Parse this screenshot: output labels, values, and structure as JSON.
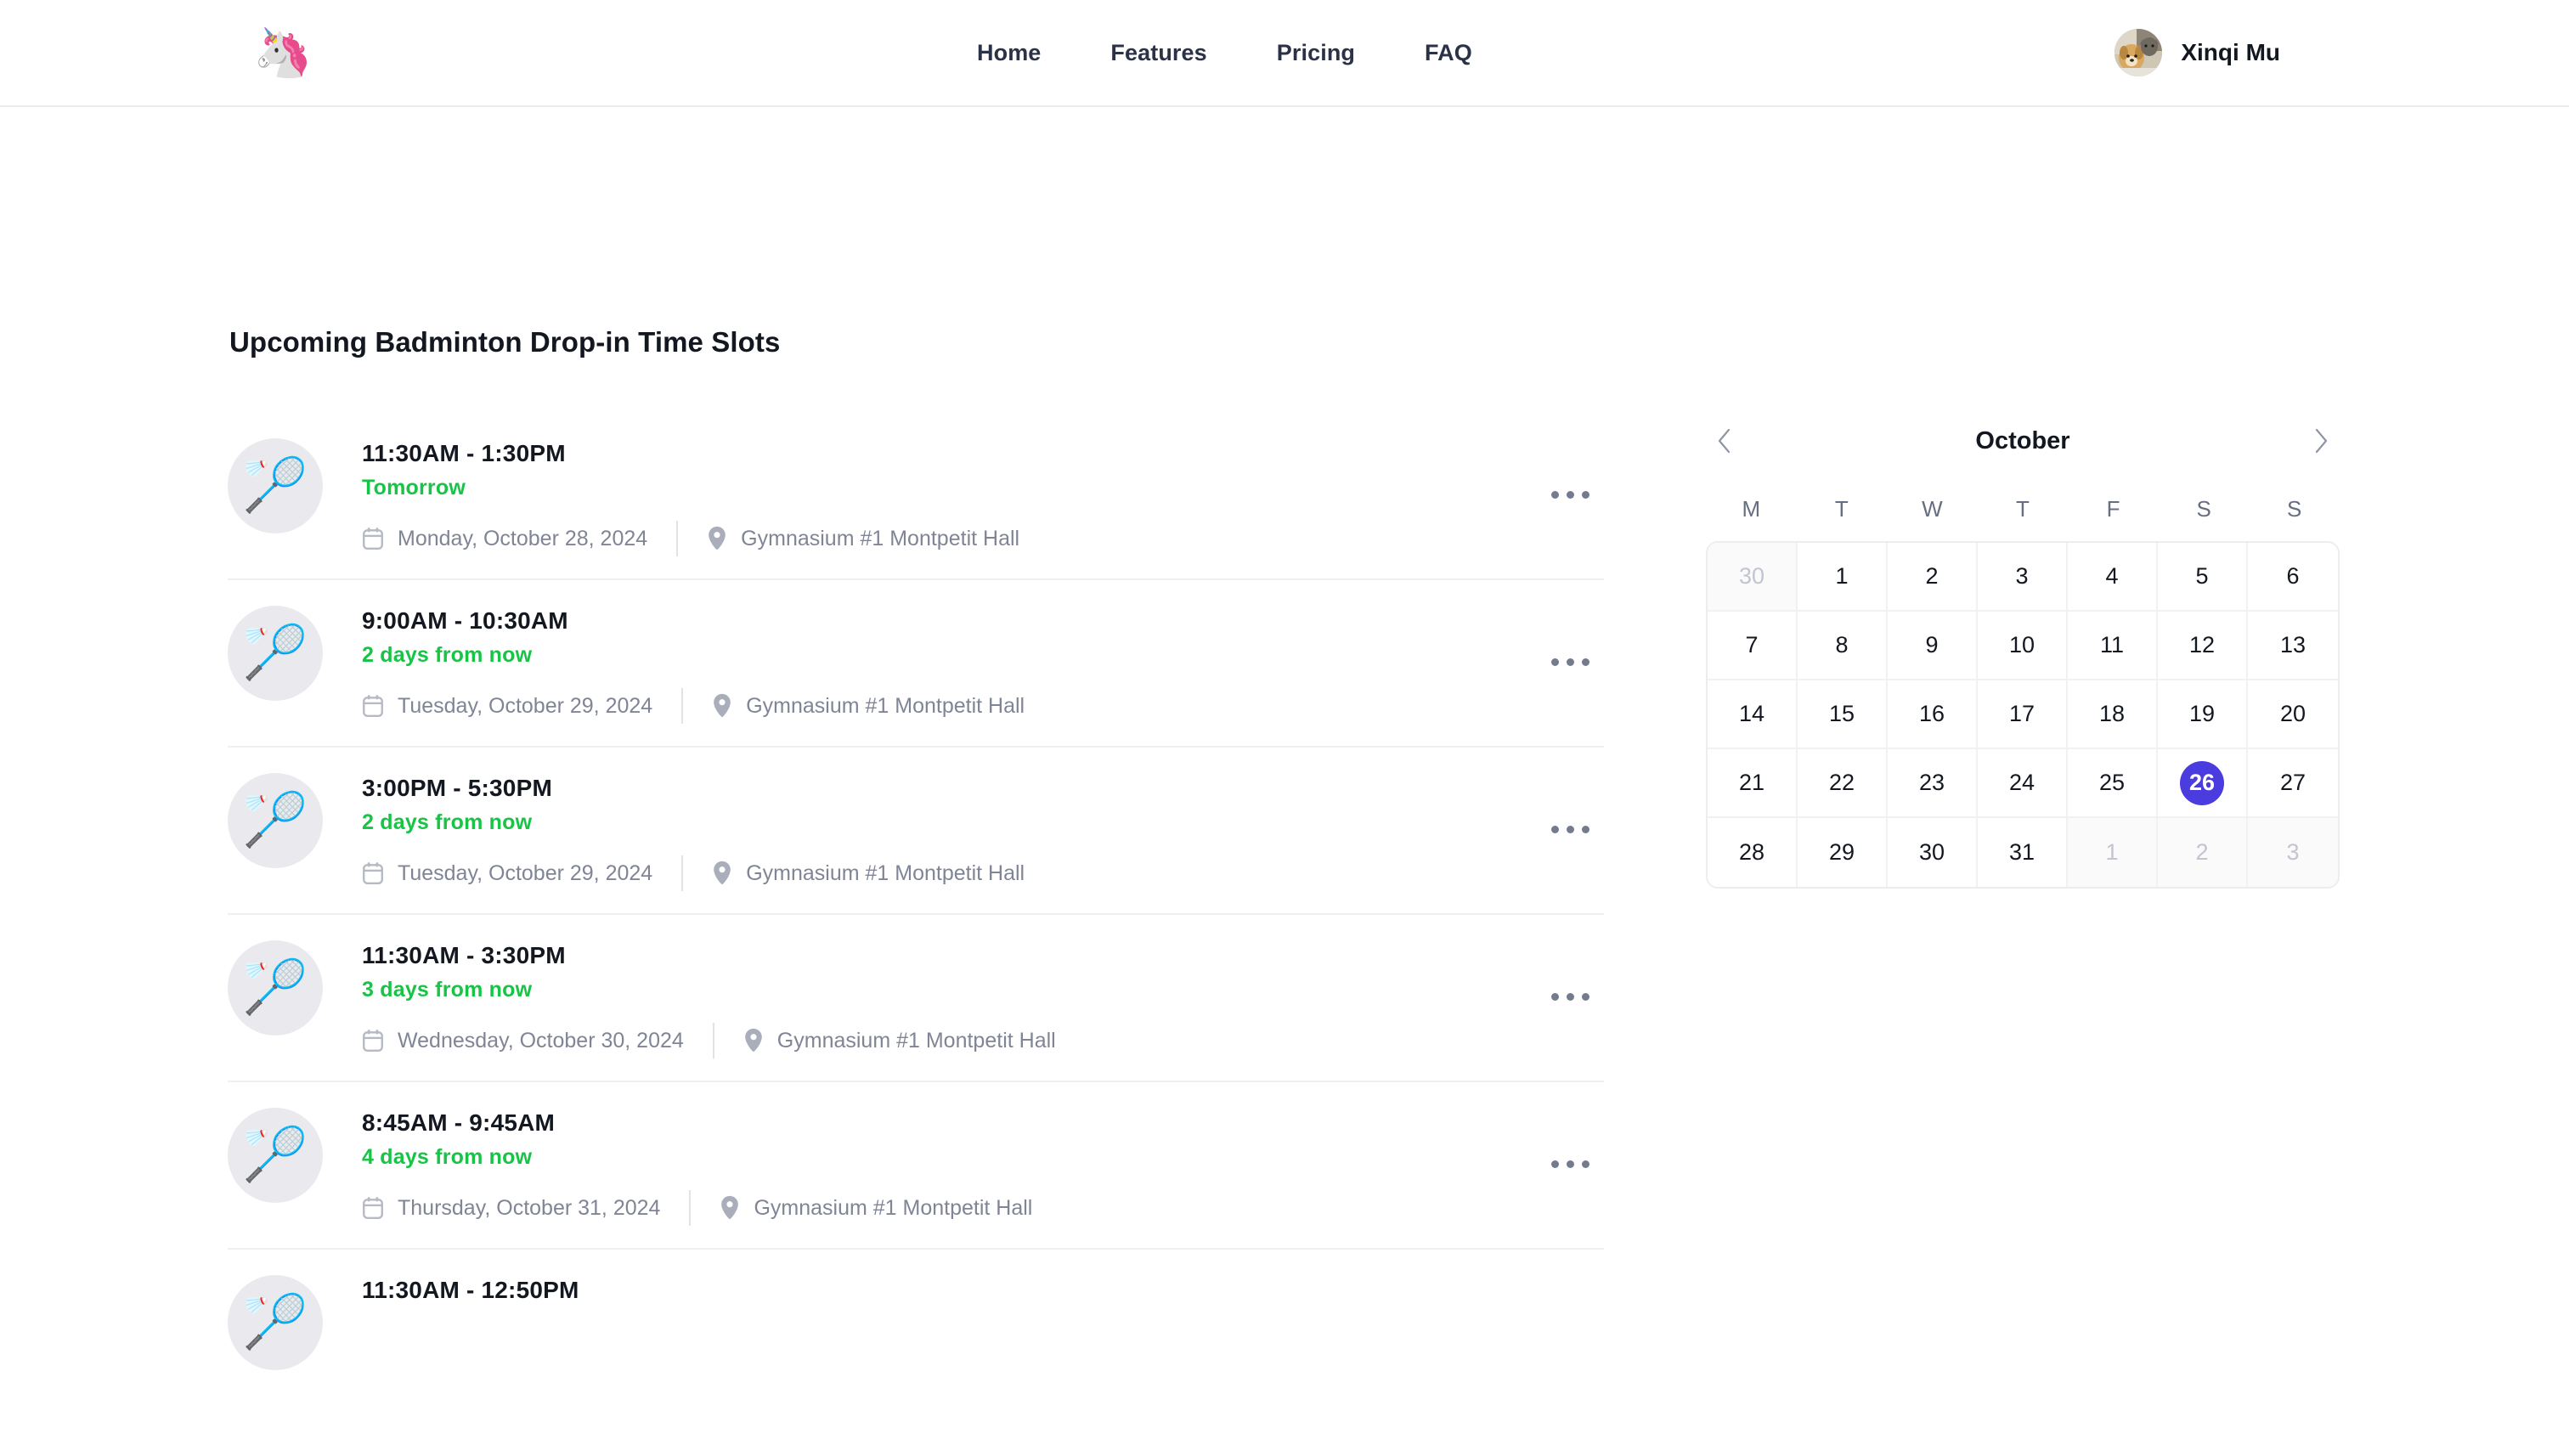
{
  "navbar": {
    "logo_icon": "unicorn-logo",
    "logo_glyph": "🦄",
    "links": [
      {
        "label": "Home"
      },
      {
        "label": "Features"
      },
      {
        "label": "Pricing"
      },
      {
        "label": "FAQ"
      }
    ],
    "user": {
      "name": "Xinqi Mu",
      "avatar_alt": "dog-and-cat-photo"
    }
  },
  "main": {
    "title": "Upcoming Badminton Drop-in Time Slots",
    "slot_emoji": "🏸",
    "slots": [
      {
        "time": "11:30AM - 1:30PM",
        "relative": "Tomorrow",
        "date": "Monday, October 28, 2024",
        "location": "Gymnasium #1 Montpetit Hall"
      },
      {
        "time": "9:00AM - 10:30AM",
        "relative": "2 days from now",
        "date": "Tuesday, October 29, 2024",
        "location": "Gymnasium #1 Montpetit Hall"
      },
      {
        "time": "3:00PM - 5:30PM",
        "relative": "2 days from now",
        "date": "Tuesday, October 29, 2024",
        "location": "Gymnasium #1 Montpetit Hall"
      },
      {
        "time": "11:30AM - 3:30PM",
        "relative": "3 days from now",
        "date": "Wednesday, October 30, 2024",
        "location": "Gymnasium #1 Montpetit Hall"
      },
      {
        "time": "8:45AM - 9:45AM",
        "relative": "4 days from now",
        "date": "Thursday, October 31, 2024",
        "location": "Gymnasium #1 Montpetit Hall"
      },
      {
        "time": "11:30AM - 12:50PM",
        "relative": "",
        "date": "",
        "location": ""
      }
    ]
  },
  "calendar": {
    "month": "October",
    "prev_icon": "chevron-left-icon",
    "next_icon": "chevron-right-icon",
    "weekdays": [
      "M",
      "T",
      "W",
      "T",
      "F",
      "S",
      "S"
    ],
    "selected_day": 26,
    "accent_color": "#4b3ce0",
    "days": [
      {
        "n": "30",
        "muted": true
      },
      {
        "n": "1",
        "muted": false
      },
      {
        "n": "2",
        "muted": false
      },
      {
        "n": "3",
        "muted": false
      },
      {
        "n": "4",
        "muted": false
      },
      {
        "n": "5",
        "muted": false
      },
      {
        "n": "6",
        "muted": false
      },
      {
        "n": "7",
        "muted": false
      },
      {
        "n": "8",
        "muted": false
      },
      {
        "n": "9",
        "muted": false
      },
      {
        "n": "10",
        "muted": false
      },
      {
        "n": "11",
        "muted": false
      },
      {
        "n": "12",
        "muted": false
      },
      {
        "n": "13",
        "muted": false
      },
      {
        "n": "14",
        "muted": false
      },
      {
        "n": "15",
        "muted": false
      },
      {
        "n": "16",
        "muted": false
      },
      {
        "n": "17",
        "muted": false
      },
      {
        "n": "18",
        "muted": false
      },
      {
        "n": "19",
        "muted": false
      },
      {
        "n": "20",
        "muted": false
      },
      {
        "n": "21",
        "muted": false
      },
      {
        "n": "22",
        "muted": false
      },
      {
        "n": "23",
        "muted": false
      },
      {
        "n": "24",
        "muted": false
      },
      {
        "n": "25",
        "muted": false
      },
      {
        "n": "26",
        "muted": false,
        "selected": true
      },
      {
        "n": "27",
        "muted": false
      },
      {
        "n": "28",
        "muted": false
      },
      {
        "n": "29",
        "muted": false
      },
      {
        "n": "30",
        "muted": false
      },
      {
        "n": "31",
        "muted": false
      },
      {
        "n": "1",
        "muted": true
      },
      {
        "n": "2",
        "muted": true
      },
      {
        "n": "3",
        "muted": true
      }
    ]
  },
  "icons": {
    "calendar": "calendar-icon",
    "location": "location-pin-icon",
    "more": "more-options-icon"
  }
}
